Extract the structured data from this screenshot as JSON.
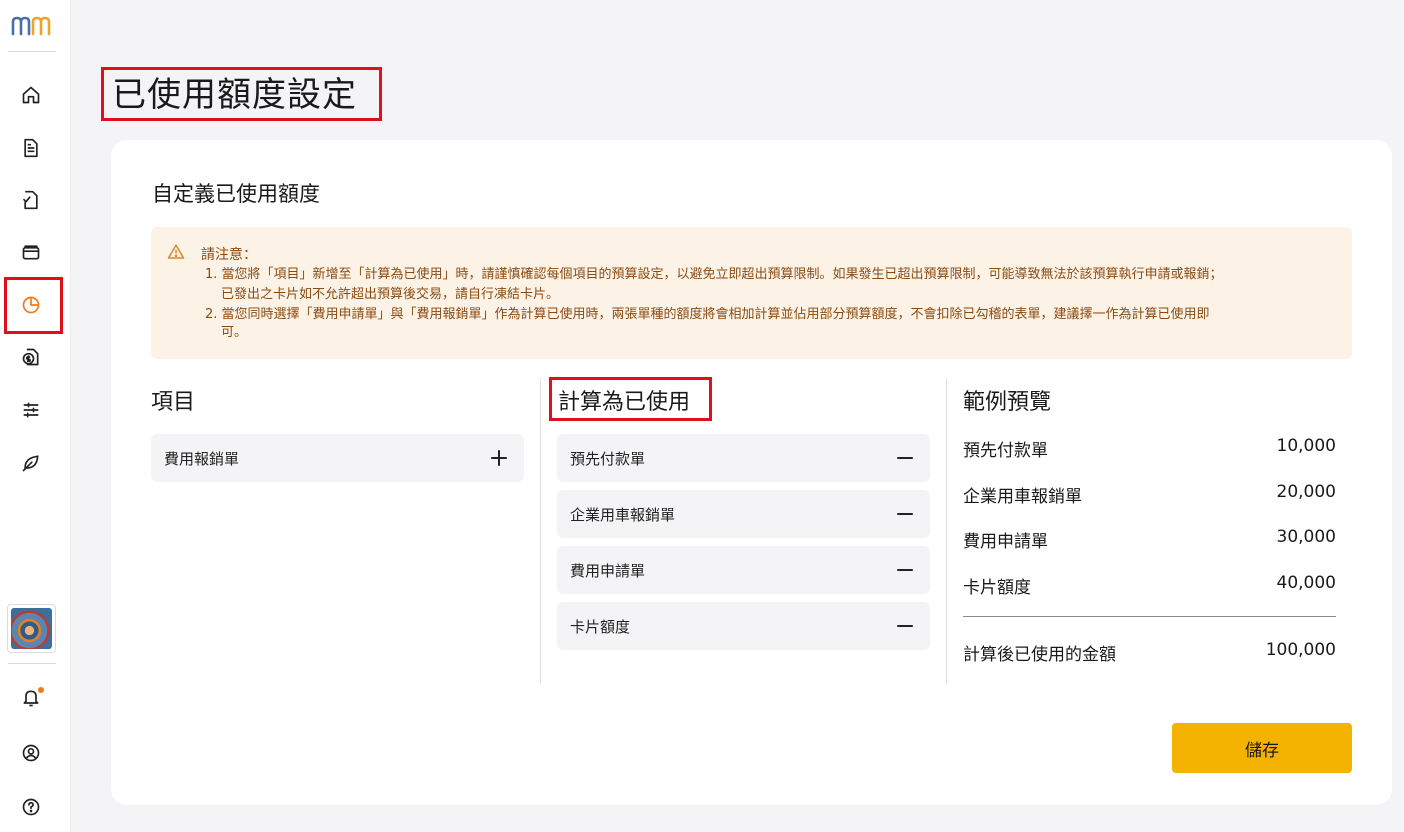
{
  "page": {
    "title": "已使用額度設定"
  },
  "card": {
    "title": "自定義已使用額度"
  },
  "notice": {
    "heading": "請注意：",
    "lines": [
      "1. 當您將「項目」新增至「計算為已使用」時，請謹慎確認每個項目的預算設定，以避免立即超出預算限制。如果發生已超出預算限制，可能導致無法於該預算執行申請或報銷；",
      "已發出之卡片如不允許超出預算後交易，請自行凍結卡片。",
      "2. 當您同時選擇「費用申請單」與「費用報銷單」作為計算已使用時，兩張單種的額度將會相加計算並佔用部分預算額度，不會扣除已勾稽的表單，建議擇一作為計算已使用即",
      "可。"
    ]
  },
  "columns": {
    "items_title": "項目",
    "used_title": "計算為已使用",
    "preview_title": "範例預覽"
  },
  "items": [
    {
      "label": "費用報銷單"
    }
  ],
  "used_items": [
    {
      "label": "預先付款單"
    },
    {
      "label": "企業用車報銷單"
    },
    {
      "label": "費用申請單"
    },
    {
      "label": "卡片額度"
    }
  ],
  "preview": {
    "rows": [
      {
        "label": "預先付款單",
        "value": "10,000"
      },
      {
        "label": "企業用車報銷單",
        "value": "20,000"
      },
      {
        "label": "費用申請單",
        "value": "30,000"
      },
      {
        "label": "卡片額度",
        "value": "40,000"
      }
    ],
    "total_label": "計算後已使用的金額",
    "total_value": "100,000"
  },
  "actions": {
    "save_label": "儲存"
  },
  "sidebar": {
    "icons": [
      "home-icon",
      "document-icon",
      "document-check-icon",
      "wallet-icon",
      "pie-chart-icon",
      "money-file-icon",
      "sliders-icon",
      "leaf-icon"
    ],
    "bottom_icons": [
      "bell-icon",
      "user-circle-icon",
      "help-icon"
    ],
    "active": "pie-chart-icon"
  },
  "colors": {
    "accent": "#f07a1a",
    "save": "#f5b301",
    "notice_bg": "#fdf2e6",
    "notice_text": "#8a4b12",
    "highlight": "#e0101a"
  }
}
